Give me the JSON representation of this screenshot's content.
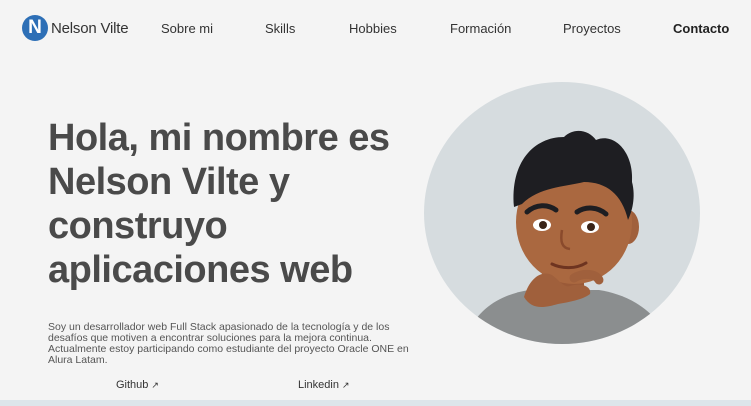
{
  "logo": {
    "badge": "N",
    "name": "Nelson Vilte"
  },
  "nav": [
    {
      "label": "Sobre mi"
    },
    {
      "label": "Skills"
    },
    {
      "label": "Hobbies"
    },
    {
      "label": "Formación"
    },
    {
      "label": "Proyectos"
    },
    {
      "label": "Contacto"
    }
  ],
  "hero": {
    "title": "Hola, mi nombre es Nelson Vilte y construyo aplicaciones web",
    "description": "Soy un desarrollador web Full Stack apasionado de la tecnología y de los desafíos que motiven a encontrar soluciones para la mejora continua. Actualmente estoy participando como estudiante del proyecto Oracle ONE en Alura Latam."
  },
  "links": {
    "github": "Github",
    "linkedin": "Linkedin",
    "arrow": "↗"
  },
  "colors": {
    "accent": "#2d6fb6",
    "background": "#f4f4f4",
    "avatar_bg": "#d6dcdf"
  }
}
